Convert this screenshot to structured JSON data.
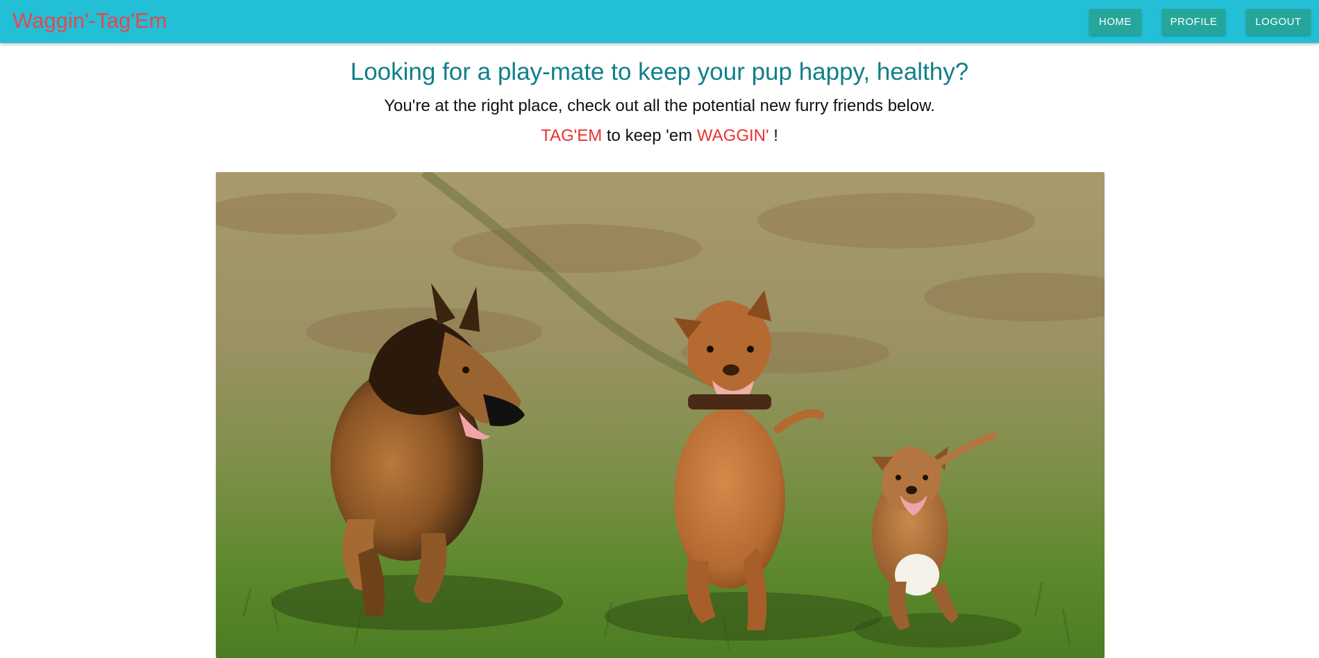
{
  "nav": {
    "brand": "Waggin'-Tag'Em",
    "home": "HOME",
    "profile": "PROFILE",
    "logout": "LOGOUT"
  },
  "hero": {
    "title": "Looking for a play-mate to keep your pup happy, healthy?",
    "subtitle": "You're at the right place, check out all the potential new furry friends below.",
    "tag_part1": "TAG'EM",
    "tag_part2": " to keep 'em ",
    "tag_part3": "WAGGIN'",
    "tag_part4": " !"
  },
  "colors": {
    "navbar": "#22bfd6",
    "brand": "#e5484d",
    "button": "#26a69a",
    "title": "#107f88",
    "accent_red": "#e8322f"
  }
}
